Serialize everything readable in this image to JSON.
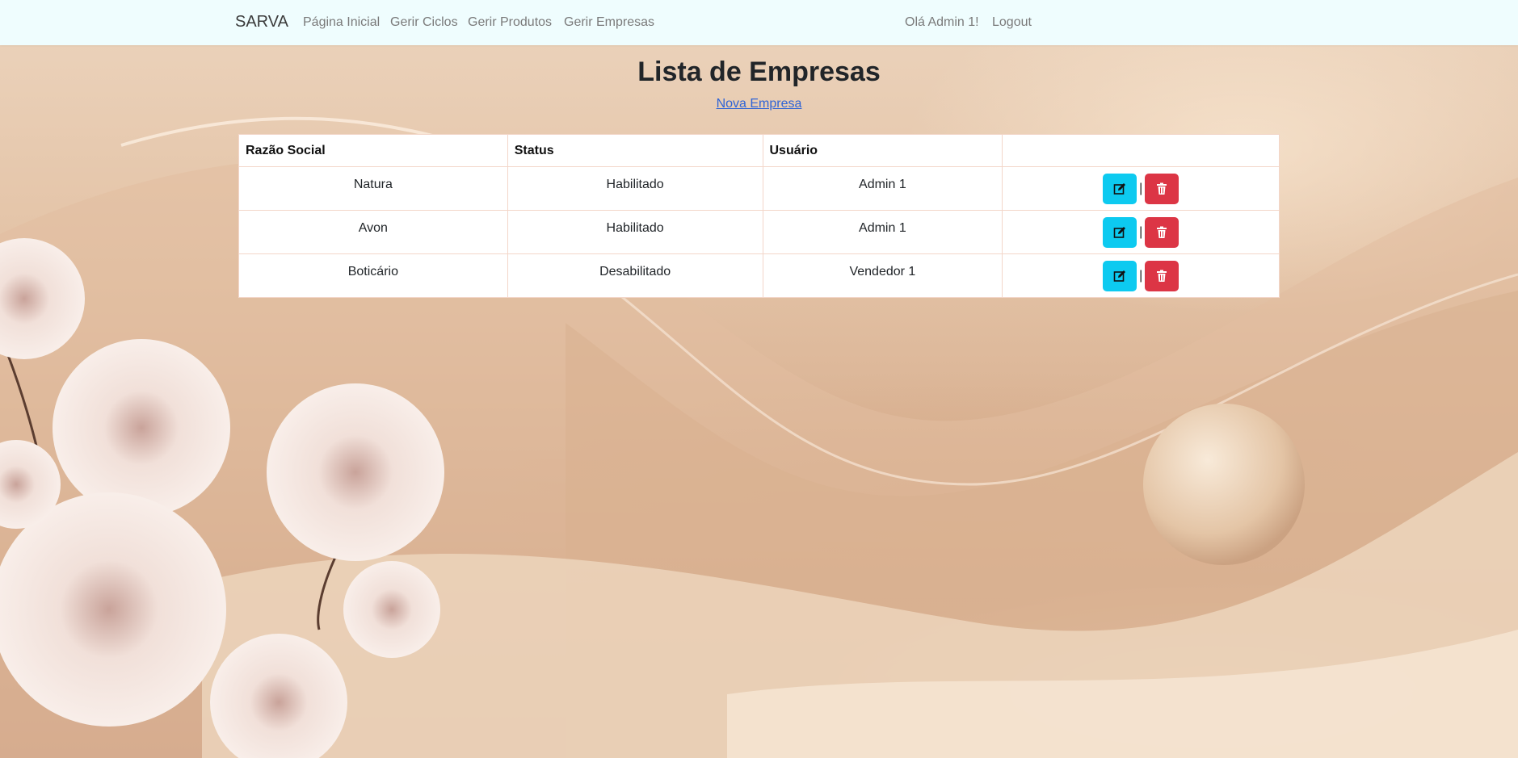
{
  "navbar": {
    "brand": "SARVA",
    "links": [
      {
        "label": "Página Inicial"
      },
      {
        "label": "Gerir Ciclos"
      },
      {
        "label": "Gerir Produtos"
      },
      {
        "label": "Gerir Empresas"
      }
    ],
    "greeting": "Olá Admin 1!",
    "logout": "Logout"
  },
  "main": {
    "title": "Lista de Empresas",
    "new_link": "Nova Empresa",
    "table": {
      "headers": [
        "Razão Social",
        "Status",
        "Usuário",
        ""
      ],
      "rows": [
        {
          "razao_social": "Natura",
          "status": "Habilitado",
          "usuario": "Admin 1"
        },
        {
          "razao_social": "Avon",
          "status": "Habilitado",
          "usuario": "Admin 1"
        },
        {
          "razao_social": "Boticário",
          "status": "Desabilitado",
          "usuario": "Vendedor 1"
        }
      ],
      "separator": "|"
    }
  },
  "icons": {
    "edit": "pencil-square-icon",
    "delete": "trash-icon"
  },
  "colors": {
    "navbar_bg": "#effdfe",
    "edit_button": "#0dcaf0",
    "delete_button": "#dc3545",
    "link": "#2f64d6"
  }
}
